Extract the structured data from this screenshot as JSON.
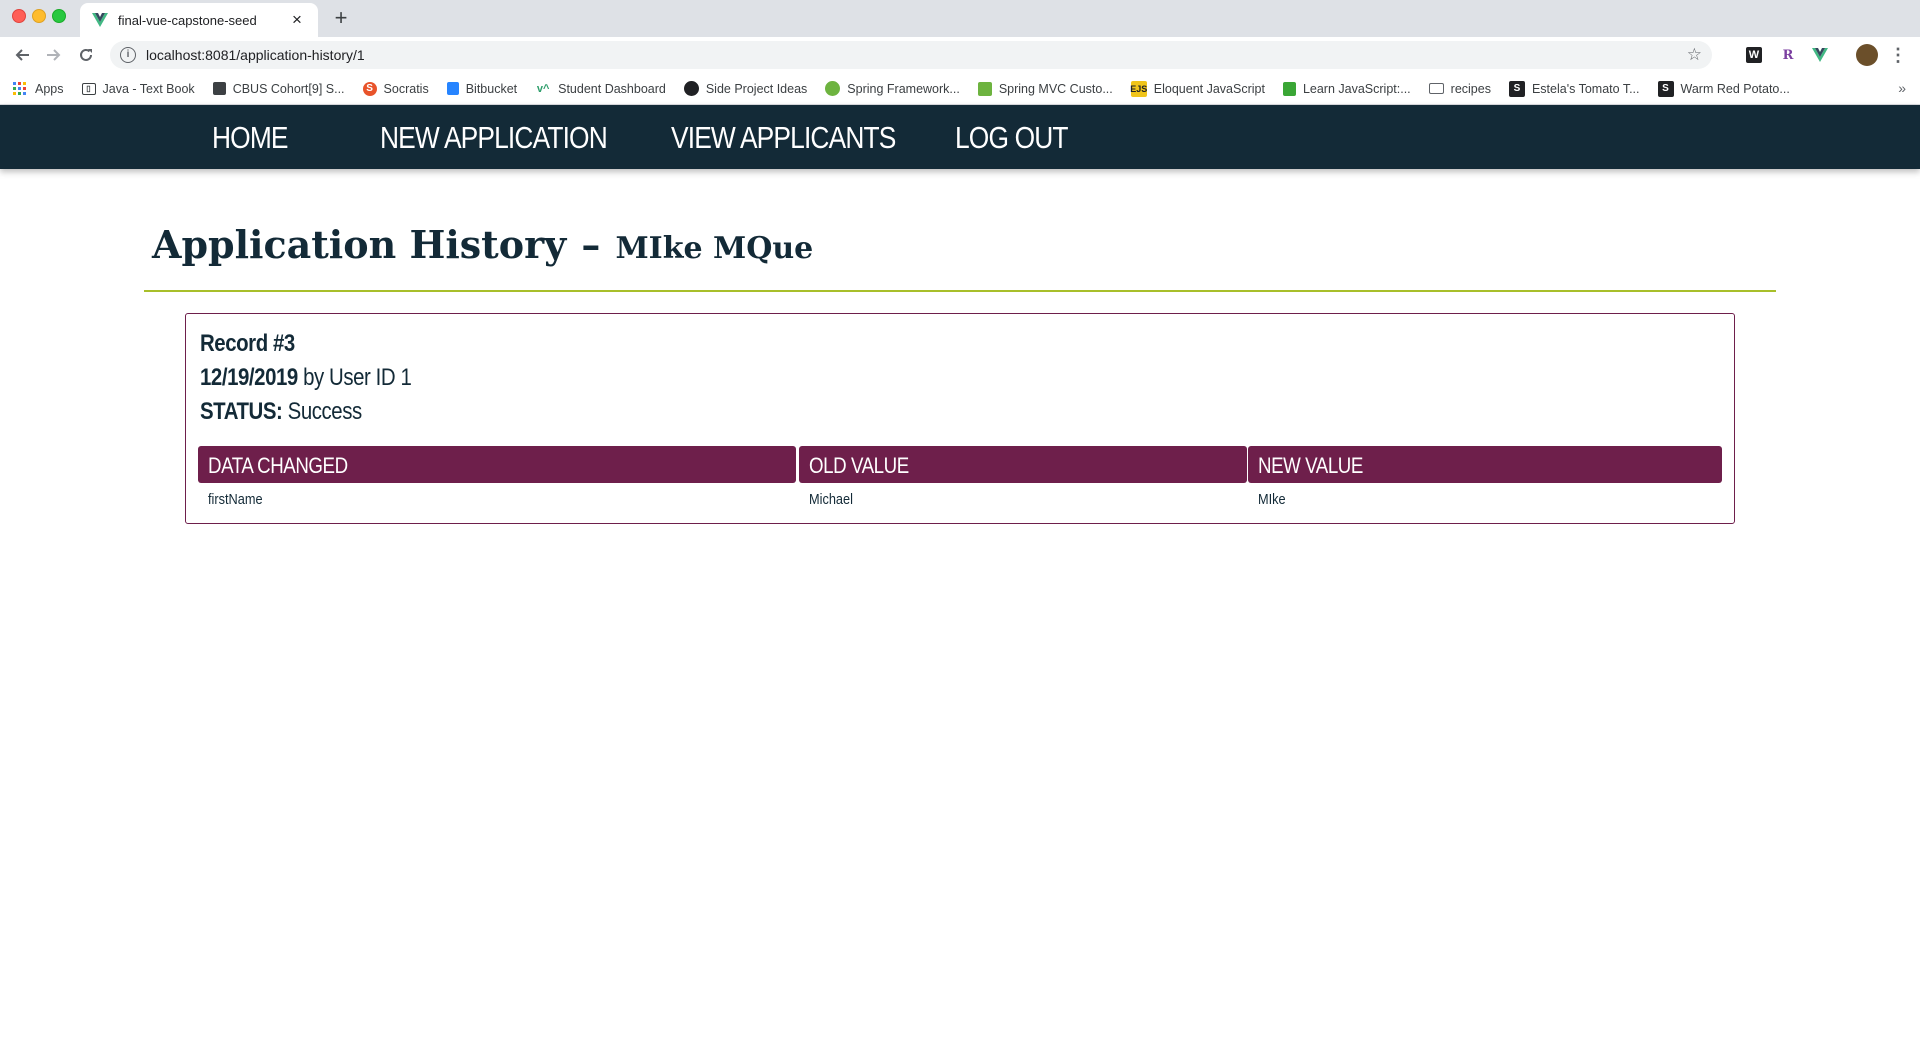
{
  "browser": {
    "tab_title": "final-vue-capstone-seed",
    "close_glyph": "×",
    "new_tab_glyph": "+",
    "url": "localhost:8081/application-history/1",
    "bookmarks": [
      {
        "label": "Apps",
        "icon": "apps-grid-icon"
      },
      {
        "label": "Java - Text Book",
        "icon": "book-icon"
      },
      {
        "label": "CBUS Cohort[9] S...",
        "icon": "trello-icon"
      },
      {
        "label": "Socratis",
        "icon": "socratis-icon"
      },
      {
        "label": "Bitbucket",
        "icon": "bitbucket-icon"
      },
      {
        "label": "Student Dashboard",
        "icon": "va-icon"
      },
      {
        "label": "Side Project Ideas",
        "icon": "github-icon"
      },
      {
        "label": "Spring Framework...",
        "icon": "spring-icon"
      },
      {
        "label": "Spring MVC Custo...",
        "icon": "leaf-icon"
      },
      {
        "label": "Eloquent JavaScript",
        "icon": "ejs-icon"
      },
      {
        "label": "Learn JavaScript:...",
        "icon": "codecademy-icon"
      },
      {
        "label": "recipes",
        "icon": "folder-icon"
      },
      {
        "label": "Estela's Tomato T...",
        "icon": "squarespace-icon"
      },
      {
        "label": "Warm Red Potato...",
        "icon": "squarespace-icon"
      }
    ],
    "more_bookmarks": "»"
  },
  "nav": {
    "home": "HOME",
    "new_application": "NEW APPLICATION",
    "view_applicants": "VIEW APPLICANTS",
    "log_out": "LOG OUT"
  },
  "page": {
    "title": "Application History",
    "dash": "–",
    "applicant_name": "MIke MQue"
  },
  "record": {
    "label": "Record #3",
    "date": "12/19/2019",
    "by_text": "by User ID 1",
    "status_label": "STATUS:",
    "status_value": "Success",
    "columns": [
      "DATA CHANGED",
      "OLD VALUE",
      "NEW VALUE"
    ],
    "rows": [
      {
        "field": "firstName",
        "old": "Michael",
        "new": "MIke"
      }
    ]
  },
  "colors": {
    "nav_bg": "#132a37",
    "accent_rule": "#a8bf2a",
    "table_header": "#6e1f4b"
  }
}
